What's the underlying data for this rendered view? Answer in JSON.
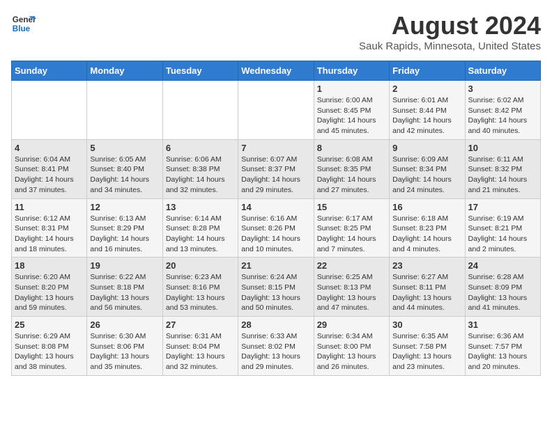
{
  "header": {
    "logo_line1": "General",
    "logo_line2": "Blue",
    "month_year": "August 2024",
    "location": "Sauk Rapids, Minnesota, United States"
  },
  "days_of_week": [
    "Sunday",
    "Monday",
    "Tuesday",
    "Wednesday",
    "Thursday",
    "Friday",
    "Saturday"
  ],
  "weeks": [
    [
      {
        "day": "",
        "info": ""
      },
      {
        "day": "",
        "info": ""
      },
      {
        "day": "",
        "info": ""
      },
      {
        "day": "",
        "info": ""
      },
      {
        "day": "1",
        "info": "Sunrise: 6:00 AM\nSunset: 8:45 PM\nDaylight: 14 hours and 45 minutes."
      },
      {
        "day": "2",
        "info": "Sunrise: 6:01 AM\nSunset: 8:44 PM\nDaylight: 14 hours and 42 minutes."
      },
      {
        "day": "3",
        "info": "Sunrise: 6:02 AM\nSunset: 8:42 PM\nDaylight: 14 hours and 40 minutes."
      }
    ],
    [
      {
        "day": "4",
        "info": "Sunrise: 6:04 AM\nSunset: 8:41 PM\nDaylight: 14 hours and 37 minutes."
      },
      {
        "day": "5",
        "info": "Sunrise: 6:05 AM\nSunset: 8:40 PM\nDaylight: 14 hours and 34 minutes."
      },
      {
        "day": "6",
        "info": "Sunrise: 6:06 AM\nSunset: 8:38 PM\nDaylight: 14 hours and 32 minutes."
      },
      {
        "day": "7",
        "info": "Sunrise: 6:07 AM\nSunset: 8:37 PM\nDaylight: 14 hours and 29 minutes."
      },
      {
        "day": "8",
        "info": "Sunrise: 6:08 AM\nSunset: 8:35 PM\nDaylight: 14 hours and 27 minutes."
      },
      {
        "day": "9",
        "info": "Sunrise: 6:09 AM\nSunset: 8:34 PM\nDaylight: 14 hours and 24 minutes."
      },
      {
        "day": "10",
        "info": "Sunrise: 6:11 AM\nSunset: 8:32 PM\nDaylight: 14 hours and 21 minutes."
      }
    ],
    [
      {
        "day": "11",
        "info": "Sunrise: 6:12 AM\nSunset: 8:31 PM\nDaylight: 14 hours and 18 minutes."
      },
      {
        "day": "12",
        "info": "Sunrise: 6:13 AM\nSunset: 8:29 PM\nDaylight: 14 hours and 16 minutes."
      },
      {
        "day": "13",
        "info": "Sunrise: 6:14 AM\nSunset: 8:28 PM\nDaylight: 14 hours and 13 minutes."
      },
      {
        "day": "14",
        "info": "Sunrise: 6:16 AM\nSunset: 8:26 PM\nDaylight: 14 hours and 10 minutes."
      },
      {
        "day": "15",
        "info": "Sunrise: 6:17 AM\nSunset: 8:25 PM\nDaylight: 14 hours and 7 minutes."
      },
      {
        "day": "16",
        "info": "Sunrise: 6:18 AM\nSunset: 8:23 PM\nDaylight: 14 hours and 4 minutes."
      },
      {
        "day": "17",
        "info": "Sunrise: 6:19 AM\nSunset: 8:21 PM\nDaylight: 14 hours and 2 minutes."
      }
    ],
    [
      {
        "day": "18",
        "info": "Sunrise: 6:20 AM\nSunset: 8:20 PM\nDaylight: 13 hours and 59 minutes."
      },
      {
        "day": "19",
        "info": "Sunrise: 6:22 AM\nSunset: 8:18 PM\nDaylight: 13 hours and 56 minutes."
      },
      {
        "day": "20",
        "info": "Sunrise: 6:23 AM\nSunset: 8:16 PM\nDaylight: 13 hours and 53 minutes."
      },
      {
        "day": "21",
        "info": "Sunrise: 6:24 AM\nSunset: 8:15 PM\nDaylight: 13 hours and 50 minutes."
      },
      {
        "day": "22",
        "info": "Sunrise: 6:25 AM\nSunset: 8:13 PM\nDaylight: 13 hours and 47 minutes."
      },
      {
        "day": "23",
        "info": "Sunrise: 6:27 AM\nSunset: 8:11 PM\nDaylight: 13 hours and 44 minutes."
      },
      {
        "day": "24",
        "info": "Sunrise: 6:28 AM\nSunset: 8:09 PM\nDaylight: 13 hours and 41 minutes."
      }
    ],
    [
      {
        "day": "25",
        "info": "Sunrise: 6:29 AM\nSunset: 8:08 PM\nDaylight: 13 hours and 38 minutes."
      },
      {
        "day": "26",
        "info": "Sunrise: 6:30 AM\nSunset: 8:06 PM\nDaylight: 13 hours and 35 minutes."
      },
      {
        "day": "27",
        "info": "Sunrise: 6:31 AM\nSunset: 8:04 PM\nDaylight: 13 hours and 32 minutes."
      },
      {
        "day": "28",
        "info": "Sunrise: 6:33 AM\nSunset: 8:02 PM\nDaylight: 13 hours and 29 minutes."
      },
      {
        "day": "29",
        "info": "Sunrise: 6:34 AM\nSunset: 8:00 PM\nDaylight: 13 hours and 26 minutes."
      },
      {
        "day": "30",
        "info": "Sunrise: 6:35 AM\nSunset: 7:58 PM\nDaylight: 13 hours and 23 minutes."
      },
      {
        "day": "31",
        "info": "Sunrise: 6:36 AM\nSunset: 7:57 PM\nDaylight: 13 hours and 20 minutes."
      }
    ]
  ]
}
